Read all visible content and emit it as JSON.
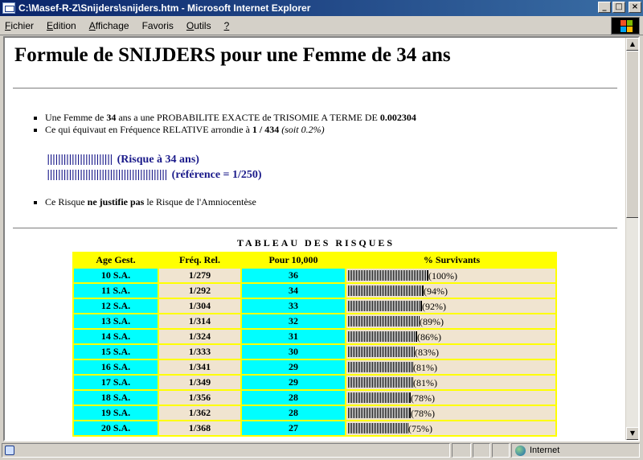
{
  "window": {
    "title": "C:\\Masef-R-Z\\Snijders\\snijders.htm - Microsoft Internet Explorer",
    "buttons": {
      "minimize": "_",
      "maximize": "□",
      "close": "×"
    }
  },
  "menu": {
    "items": [
      {
        "label": "Fichier",
        "u": "F",
        "rest": "ichier"
      },
      {
        "label": "Edition",
        "u": "E",
        "rest": "dition"
      },
      {
        "label": "Affichage",
        "u": "A",
        "rest": "ffichage"
      },
      {
        "label": "Favoris",
        "u": "",
        "rest": "Favoris"
      },
      {
        "label": "Outils",
        "u": "O",
        "rest": "utils"
      },
      {
        "label": "?",
        "u": "?",
        "rest": ""
      }
    ]
  },
  "page": {
    "heading": "Formule de SNIJDERS pour une Femme de 34 ans",
    "bullet1": {
      "pre": "Une Femme de ",
      "age": "34",
      "mid": " ans a une PROBABILITE EXACTE de TRISOMIE A TERME DE ",
      "prob": "0.002304"
    },
    "bullet2": {
      "pre": "Ce qui équivaut en Fréquence RELATIVE arrondie à ",
      "freq": "1 / 434",
      "post": " (soit 0.2%)"
    },
    "risk_bars": [
      {
        "ticks": "||||||||||||||||||||||||",
        "label": "(Risque à 34 ans)"
      },
      {
        "ticks": "||||||||||||||||||||||||||||||||||||||||||||",
        "label": "(référence = 1/250)"
      }
    ],
    "bullet3": {
      "pre": "Ce Risque ",
      "strong": "ne justifie pas",
      "post": " le Risque de l'Amniocentèse"
    }
  },
  "table": {
    "title": "TABLEAU DES RISQUES",
    "headers": [
      "Age Gest.",
      "Fréq. Rel.",
      "Pour 10,000",
      "% Survivants"
    ],
    "rows": [
      {
        "age": "10 S.A.",
        "freq": "1/279",
        "pour": "36",
        "pct": "(100%)",
        "v": 100
      },
      {
        "age": "11 S.A.",
        "freq": "1/292",
        "pour": "34",
        "pct": "(94%)",
        "v": 94
      },
      {
        "age": "12 S.A.",
        "freq": "1/304",
        "pour": "33",
        "pct": "(92%)",
        "v": 92
      },
      {
        "age": "13 S.A.",
        "freq": "1/314",
        "pour": "32",
        "pct": "(89%)",
        "v": 89
      },
      {
        "age": "14 S.A.",
        "freq": "1/324",
        "pour": "31",
        "pct": "(86%)",
        "v": 86
      },
      {
        "age": "15 S.A.",
        "freq": "1/333",
        "pour": "30",
        "pct": "(83%)",
        "v": 83
      },
      {
        "age": "16 S.A.",
        "freq": "1/341",
        "pour": "29",
        "pct": "(81%)",
        "v": 81
      },
      {
        "age": "17 S.A.",
        "freq": "1/349",
        "pour": "29",
        "pct": "(81%)",
        "v": 81
      },
      {
        "age": "18 S.A.",
        "freq": "1/356",
        "pour": "28",
        "pct": "(78%)",
        "v": 78
      },
      {
        "age": "19 S.A.",
        "freq": "1/362",
        "pour": "28",
        "pct": "(78%)",
        "v": 78
      },
      {
        "age": "20 S.A.",
        "freq": "1/368",
        "pour": "27",
        "pct": "(75%)",
        "v": 75
      }
    ]
  },
  "status": {
    "zone": "Internet"
  },
  "colors": {
    "header_bg": "#ffff00",
    "cyan_cell": "#00ffff",
    "beige_cell": "#f0e4d0",
    "risk_text": "#1a1a8a"
  }
}
